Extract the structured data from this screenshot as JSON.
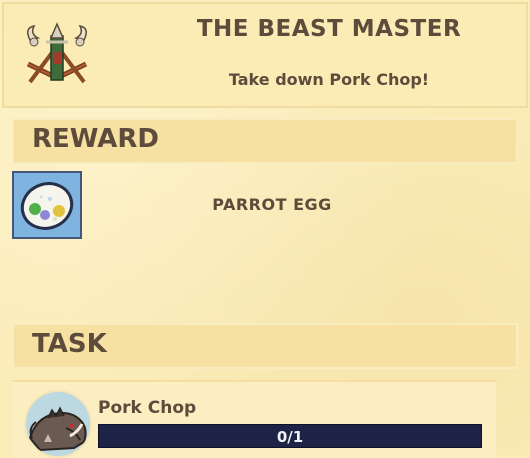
{
  "quest": {
    "title": "THE BEAST MASTER",
    "description": "Take down Pork Chop!",
    "icon": "crossbow-trophy-icon"
  },
  "reward": {
    "header": "REWARD",
    "items": [
      {
        "name": "PARROT EGG",
        "icon": "parrot-egg-icon"
      }
    ]
  },
  "task": {
    "header": "TASK",
    "items": [
      {
        "name": "Pork Chop",
        "icon": "boar-icon",
        "progress_text": "0/1",
        "progress_current": 0,
        "progress_total": 1
      }
    ]
  },
  "colors": {
    "background": "#fbedb8",
    "text": "#5d4c3b",
    "progress_track": "#1d2347",
    "reward_slot": "#7fb4e0"
  }
}
